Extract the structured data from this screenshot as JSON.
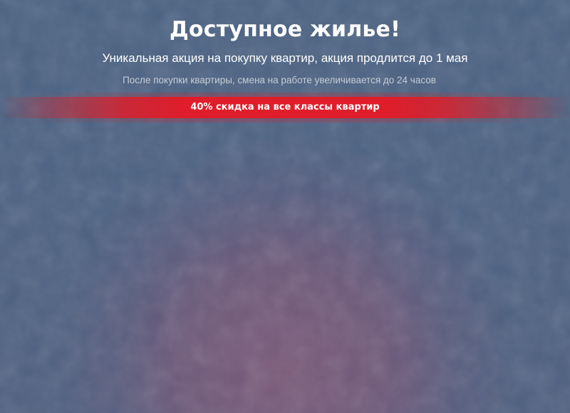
{
  "hero": {
    "title": "Доступное жилье!",
    "subtitle": "Уникальная акция на покупку квартир, акция продлится до 1 мая",
    "note": "После покупки квартиры, смена на работе увеличивается до 24 часов"
  },
  "promo": {
    "text": "40% скидка на все классы квартир"
  },
  "colors": {
    "background": "#4a6281",
    "accent_red": "#df1d2b",
    "glow": "#7d5a78"
  }
}
